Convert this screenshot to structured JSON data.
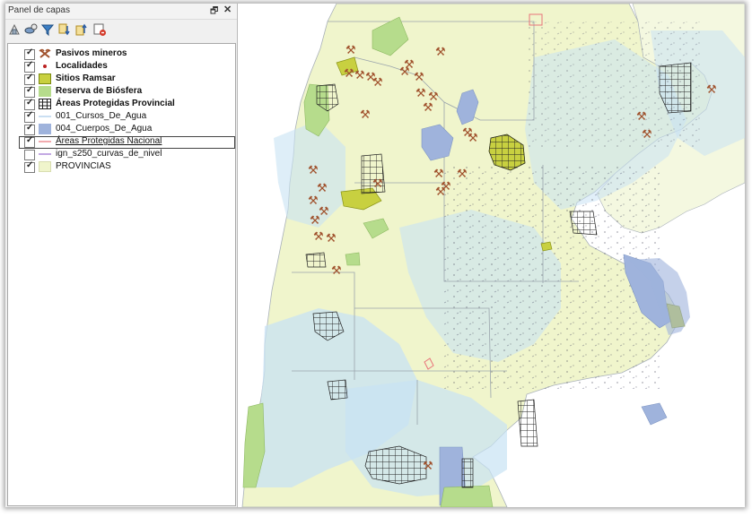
{
  "panel": {
    "title": "Panel de capas",
    "float_icon": "🗗",
    "close_icon": "✕",
    "toolbar": [
      {
        "name": "open-layer-styling-icon"
      },
      {
        "name": "add-group-icon"
      },
      {
        "name": "filter-legend-icon"
      },
      {
        "name": "expand-all-icon"
      },
      {
        "name": "collapse-all-icon"
      },
      {
        "name": "remove-layer-icon"
      }
    ],
    "layers": [
      {
        "label": "Pasivos mineros",
        "checked": true,
        "bold": true,
        "symbol": "pick"
      },
      {
        "label": "Localidades",
        "checked": true,
        "bold": true,
        "symbol": "dot"
      },
      {
        "label": "Sitios Ramsar",
        "checked": true,
        "bold": true,
        "symbol": "ramsar"
      },
      {
        "label": "Reserva de Biósfera",
        "checked": true,
        "bold": true,
        "symbol": "biosfera"
      },
      {
        "label": "Áreas Protegidas Provincial",
        "checked": true,
        "bold": true,
        "symbol": "grid"
      },
      {
        "label": "001_Cursos_De_Agua",
        "checked": true,
        "bold": false,
        "symbol": "line-blue"
      },
      {
        "label": "004_Cuerpos_De_Agua",
        "checked": true,
        "bold": false,
        "symbol": "water"
      },
      {
        "label": "Áreas Protegidas Nacional",
        "checked": true,
        "bold": false,
        "symbol": "line-red"
      },
      {
        "label": "ign_s250_curvas_de_nivel",
        "checked": false,
        "bold": false,
        "symbol": "line-purple"
      },
      {
        "label": "PROVINCIAS",
        "checked": true,
        "bold": false,
        "symbol": "province"
      }
    ]
  },
  "colors": {
    "province": "#f0f5cc",
    "water_body": "#9fb3dc",
    "river_area": "#c8e2f4",
    "ramsar": "#c8d040",
    "biosfera": "#b6dc8c",
    "mining": "#a0522d"
  },
  "map": {
    "mining_icon": "⚒"
  }
}
